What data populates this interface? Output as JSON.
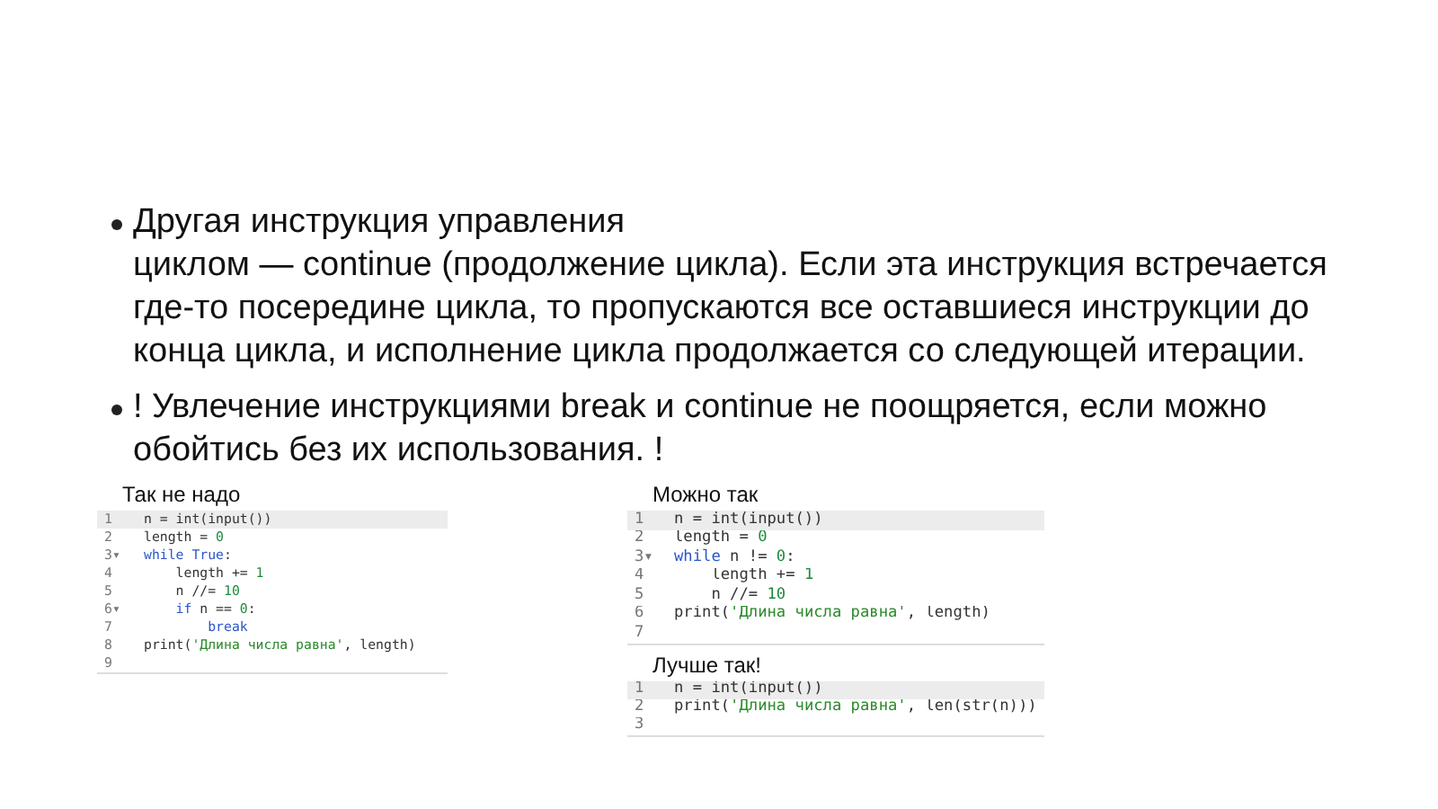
{
  "bullets": [
    {
      "text": "Другая инструкция управления\nциклом — continue (продолжение цикла). Если эта инструкция встречается где-то посередине цикла, то пропускаются все оставшиеся инструкции до конца цикла, и исполнение цикла продолжается со следующей итерации."
    },
    {
      "text": "! Увлечение инструкциями break и continue не поощряется, если можно обойтись без их использования. !"
    }
  ],
  "examples": [
    {
      "label": "Так не надо",
      "code": [
        {
          "number": "1",
          "active": true,
          "tokens": [
            {
              "text": "n = int(input())",
              "kind": "plain"
            }
          ]
        },
        {
          "number": "2",
          "active": false,
          "tokens": [
            {
              "text": "length = ",
              "kind": "plain"
            },
            {
              "text": "0",
              "kind": "num"
            }
          ]
        },
        {
          "number": "3▾",
          "active": false,
          "tokens": [
            {
              "text": "while True",
              "kind": "kw"
            },
            {
              "text": ":",
              "kind": "plain"
            }
          ]
        },
        {
          "number": "4",
          "active": false,
          "tokens": [
            {
              "text": "    length += ",
              "kind": "plain"
            },
            {
              "text": "1",
              "kind": "num"
            }
          ]
        },
        {
          "number": "5",
          "active": false,
          "tokens": [
            {
              "text": "    n //= ",
              "kind": "plain"
            },
            {
              "text": "10",
              "kind": "num"
            }
          ]
        },
        {
          "number": "6▾",
          "active": false,
          "tokens": [
            {
              "text": "    if",
              "kind": "kw"
            },
            {
              "text": " n == ",
              "kind": "plain"
            },
            {
              "text": "0",
              "kind": "num"
            },
            {
              "text": ":",
              "kind": "plain"
            }
          ]
        },
        {
          "number": "7",
          "active": false,
          "tokens": [
            {
              "text": "        break",
              "kind": "kw"
            }
          ]
        },
        {
          "number": "8",
          "active": false,
          "tokens": [
            {
              "text": "print(",
              "kind": "plain"
            },
            {
              "text": "'Длина числа равна'",
              "kind": "str"
            },
            {
              "text": ", length)",
              "kind": "plain"
            }
          ]
        },
        {
          "number": "9",
          "active": false
        }
      ]
    },
    {
      "label": "Можно так",
      "code": [
        {
          "number": "1",
          "active": true,
          "tokens": [
            {
              "text": "n = int(input())",
              "kind": "plain"
            }
          ]
        },
        {
          "number": "2",
          "active": false,
          "tokens": [
            {
              "text": "length = ",
              "kind": "plain"
            },
            {
              "text": "0",
              "kind": "num"
            }
          ]
        },
        {
          "number": "3▾",
          "active": false,
          "tokens": [
            {
              "text": "while",
              "kind": "kw"
            },
            {
              "text": " n != ",
              "kind": "plain"
            },
            {
              "text": "0",
              "kind": "num"
            },
            {
              "text": ":",
              "kind": "plain"
            }
          ]
        },
        {
          "number": "4",
          "active": false,
          "tokens": [
            {
              "text": "    length += ",
              "kind": "plain"
            },
            {
              "text": "1",
              "kind": "num"
            }
          ]
        },
        {
          "number": "5",
          "active": false,
          "tokens": [
            {
              "text": "    n //= ",
              "kind": "plain"
            },
            {
              "text": "10",
              "kind": "num"
            }
          ]
        },
        {
          "number": "6",
          "active": false,
          "tokens": [
            {
              "text": "print(",
              "kind": "plain"
            },
            {
              "text": "'Длина числа равна'",
              "kind": "str"
            },
            {
              "text": ", length)",
              "kind": "plain"
            }
          ]
        },
        {
          "number": "7",
          "active": false
        }
      ]
    },
    {
      "label": "Лучше так!",
      "code": [
        {
          "number": "1",
          "active": true,
          "tokens": [
            {
              "text": "n = int(input())",
              "kind": "plain"
            }
          ]
        },
        {
          "number": "2",
          "active": false,
          "tokens": [
            {
              "text": "print(",
              "kind": "plain"
            },
            {
              "text": "'Длина числа равна'",
              "kind": "str"
            },
            {
              "text": ", len(str(n)))",
              "kind": "plain"
            }
          ]
        },
        {
          "number": "3",
          "active": false
        }
      ]
    }
  ]
}
